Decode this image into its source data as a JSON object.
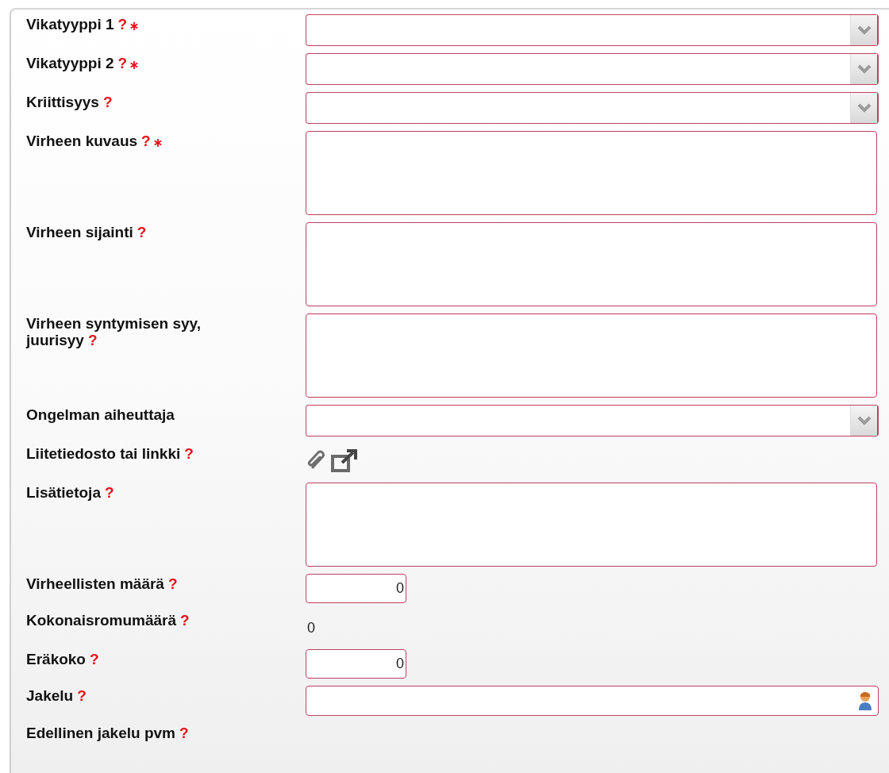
{
  "fields": [
    {
      "label": "Vikatyyppi 1",
      "help": "?",
      "required": true,
      "kind": "select"
    },
    {
      "label": "Vikatyyppi 2",
      "help": "?",
      "required": true,
      "kind": "select"
    },
    {
      "label": "Kriittisyys",
      "help": "?",
      "required": false,
      "kind": "select"
    },
    {
      "label": "Virheen kuvaus",
      "help": "?",
      "required": true,
      "kind": "textarea"
    },
    {
      "label": "Virheen sijainti",
      "help": "?",
      "required": false,
      "kind": "textarea"
    },
    {
      "label": "Virheen syntymisen syy,",
      "label_line_2": "juurisyy",
      "help": "?",
      "required": false,
      "kind": "textarea"
    },
    {
      "label": "Ongelman aiheuttaja",
      "required": false,
      "kind": "select"
    },
    {
      "label": "Liitetiedosto tai linkki",
      "help": "?",
      "required": false,
      "kind": "attachment"
    },
    {
      "label": "Lisätietoja",
      "help": "?",
      "required": false,
      "kind": "textarea"
    },
    {
      "label": "Virheellisten määrä",
      "help": "?",
      "required": false,
      "kind": "number",
      "value": "0"
    },
    {
      "label": "Kokonaisromumäärä",
      "help": "?",
      "required": false,
      "kind": "readonly",
      "value": "0"
    },
    {
      "label": "Eräkoko",
      "help": "?",
      "required": false,
      "kind": "number",
      "value": "0"
    },
    {
      "label": "Jakelu",
      "help": "?",
      "required": false,
      "kind": "person"
    },
    {
      "label": "Edellinen jakelu pvm",
      "help": "?",
      "required": false,
      "kind": "empty"
    }
  ]
}
